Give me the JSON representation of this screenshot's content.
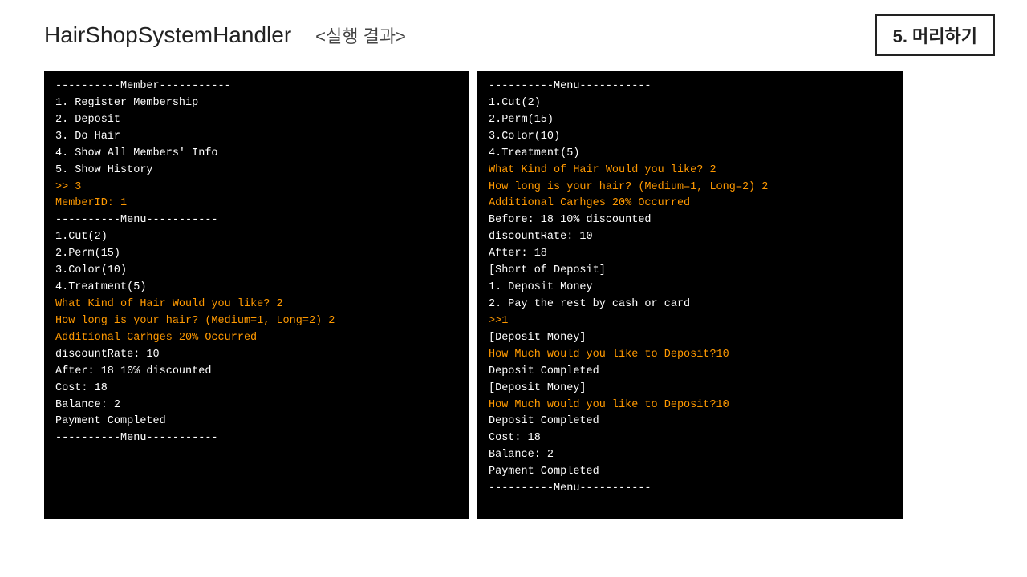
{
  "header": {
    "title": "HairShopSystemHandler",
    "subtitle": "<실행 결과>",
    "badge": "5. 머리하기"
  },
  "terminal_left": {
    "lines": [
      {
        "text": "----------Member-----------",
        "type": "normal"
      },
      {
        "text": "1.  Register Membership",
        "type": "normal"
      },
      {
        "text": "2.  Deposit",
        "type": "normal"
      },
      {
        "text": "3.  Do Hair",
        "type": "normal"
      },
      {
        "text": "4.  Show All Members' Info",
        "type": "normal"
      },
      {
        "text": "5.  Show History",
        "type": "normal"
      },
      {
        "text": ">> 3",
        "type": "highlight"
      },
      {
        "text": "MemberID: 1",
        "type": "highlight"
      },
      {
        "text": "----------Menu-----------",
        "type": "normal"
      },
      {
        "text": "1.Cut(2)",
        "type": "normal"
      },
      {
        "text": "2.Perm(15)",
        "type": "normal"
      },
      {
        "text": "3.Color(10)",
        "type": "normal"
      },
      {
        "text": "4.Treatment(5)",
        "type": "normal"
      },
      {
        "text": "What Kind of Hair Would you like? 2",
        "type": "highlight"
      },
      {
        "text": "How long is your hair? (Medium=1, Long=2) 2",
        "type": "highlight"
      },
      {
        "text": "Additional Carhges 20% Occurred",
        "type": "highlight"
      },
      {
        "text": "discountRate: 10",
        "type": "normal"
      },
      {
        "text": "After: 18 10% discounted",
        "type": "normal"
      },
      {
        "text": "Cost: 18",
        "type": "normal"
      },
      {
        "text": "Balance: 2",
        "type": "normal"
      },
      {
        "text": "Payment Completed",
        "type": "normal"
      },
      {
        "text": "----------Menu-----------",
        "type": "normal"
      }
    ]
  },
  "terminal_right": {
    "lines": [
      {
        "text": "----------Menu-----------",
        "type": "normal"
      },
      {
        "text": "1.Cut(2)",
        "type": "normal"
      },
      {
        "text": "2.Perm(15)",
        "type": "normal"
      },
      {
        "text": "3.Color(10)",
        "type": "normal"
      },
      {
        "text": "4.Treatment(5)",
        "type": "normal"
      },
      {
        "text": "What Kind of Hair Would you like? 2",
        "type": "highlight"
      },
      {
        "text": "How long is your hair? (Medium=1, Long=2) 2",
        "type": "highlight"
      },
      {
        "text": "Additional Carhges 20% Occurred",
        "type": "highlight"
      },
      {
        "text": "Before: 18 10% discounted",
        "type": "normal"
      },
      {
        "text": "discountRate: 10",
        "type": "normal"
      },
      {
        "text": "After: 18",
        "type": "normal"
      },
      {
        "text": "[Short of Deposit]",
        "type": "normal"
      },
      {
        "text": "1. Deposit Money",
        "type": "normal"
      },
      {
        "text": "2. Pay the rest by cash or card",
        "type": "normal"
      },
      {
        "text": ">>1",
        "type": "highlight"
      },
      {
        "text": "[Deposit Money]",
        "type": "normal"
      },
      {
        "text": "How Much would you like to Deposit?10",
        "type": "highlight"
      },
      {
        "text": "Deposit Completed",
        "type": "normal"
      },
      {
        "text": "",
        "type": "normal"
      },
      {
        "text": "[Deposit Money]",
        "type": "normal"
      },
      {
        "text": "How Much would you like to Deposit?10",
        "type": "highlight"
      },
      {
        "text": "Deposit Completed",
        "type": "normal"
      },
      {
        "text": "",
        "type": "normal"
      },
      {
        "text": "Cost: 18",
        "type": "normal"
      },
      {
        "text": "Balance: 2",
        "type": "normal"
      },
      {
        "text": "Payment Completed",
        "type": "normal"
      },
      {
        "text": "----------Menu-----------",
        "type": "normal"
      }
    ]
  }
}
